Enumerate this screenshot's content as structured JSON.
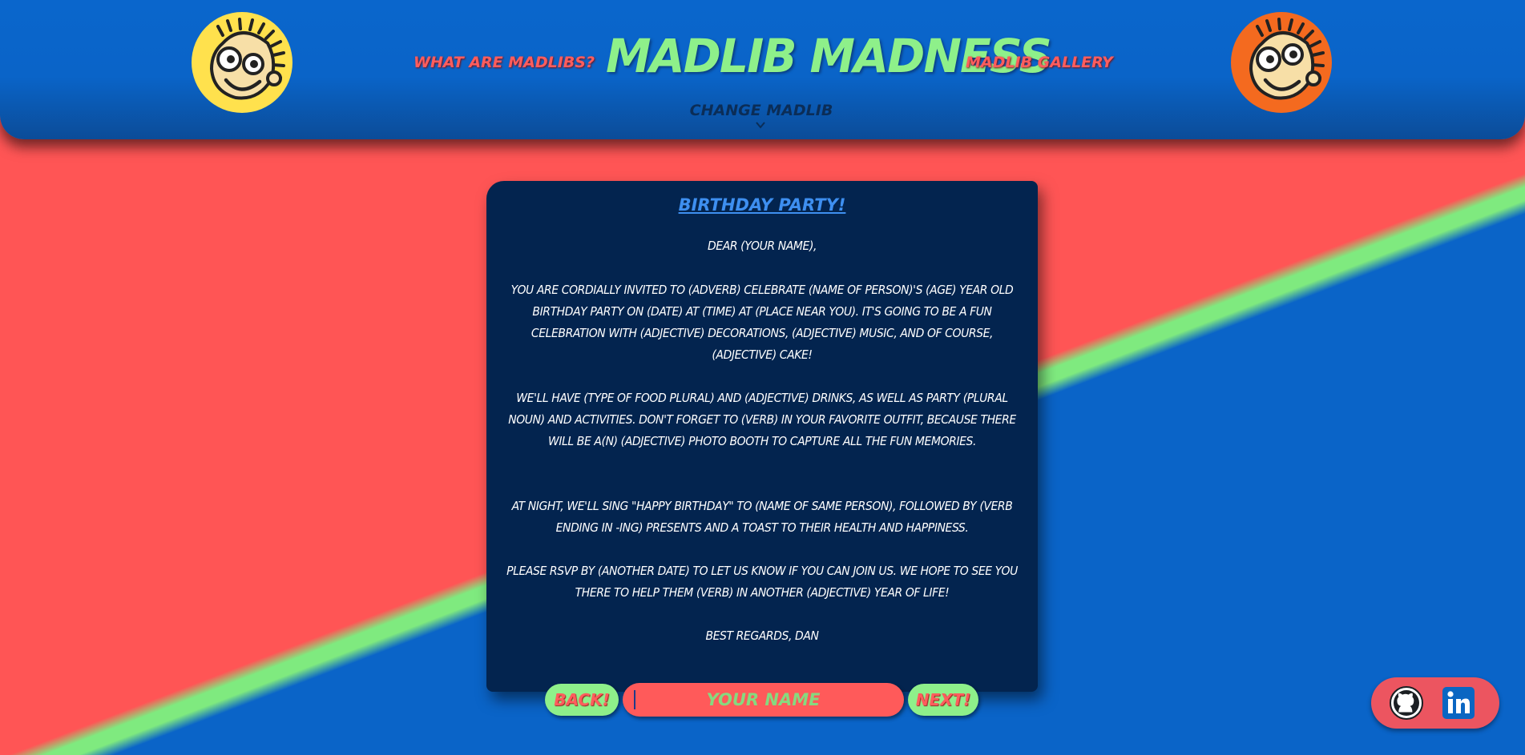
{
  "header": {
    "title": "MADLIB MADNESS",
    "nav_left": "WHAT ARE MADLIBS?",
    "nav_right": "MADLIB GALLERY",
    "change_label": "CHANGE MADLIB",
    "left_face_icon": "smiley-face-icon",
    "right_face_icon": "smiley-face-icon"
  },
  "story": {
    "title": "BIRTHDAY PARTY!",
    "paragraphs": [
      "DEAR (YOUR NAME),",
      "YOU ARE CORDIALLY INVITED TO (ADVERB) CELEBRATE (NAME OF PERSON)'S (AGE) YEAR OLD BIRTHDAY PARTY ON (DATE) AT (TIME) AT (PLACE NEAR YOU). IT'S GOING TO BE A FUN CELEBRATION WITH (ADJECTIVE) DECORATIONS, (ADJECTIVE) MUSIC, AND OF COURSE, (ADJECTIVE) CAKE!",
      "WE'LL HAVE (TYPE OF FOOD PLURAL) AND (ADJECTIVE) DRINKS, AS WELL AS PARTY (PLURAL NOUN) AND ACTIVITIES. DON'T FORGET TO (VERB) IN YOUR FAVORITE OUTFIT, BECAUSE THERE WILL BE A(N) (ADJECTIVE) PHOTO BOOTH TO CAPTURE ALL THE FUN MEMORIES.",
      "AT NIGHT, WE'LL SING \"HAPPY BIRTHDAY\" TO (NAME OF SAME PERSON), FOLLOWED BY (VERB ENDING IN -ING) PRESENTS AND A TOAST TO THEIR HEALTH AND HAPPINESS.",
      "PLEASE RSVP BY (ANOTHER DATE) TO LET US KNOW IF YOU CAN JOIN US. WE HOPE TO SEE YOU THERE TO HELP THEM (VERB) IN ANOTHER (ADJECTIVE) YEAR OF LIFE!",
      "BEST REGARDS, DAN"
    ]
  },
  "controls": {
    "back_label": "BACK!",
    "next_label": "NEXT!",
    "input_value": "",
    "input_placeholder": "YOUR NAME"
  },
  "social": {
    "github_icon": "github-icon",
    "linkedin_icon": "linkedin-icon"
  },
  "colors": {
    "primary_blue": "#0a64c8",
    "accent_red": "#ff5555",
    "accent_green": "#8ef08a",
    "card_bg": "#03244f"
  }
}
